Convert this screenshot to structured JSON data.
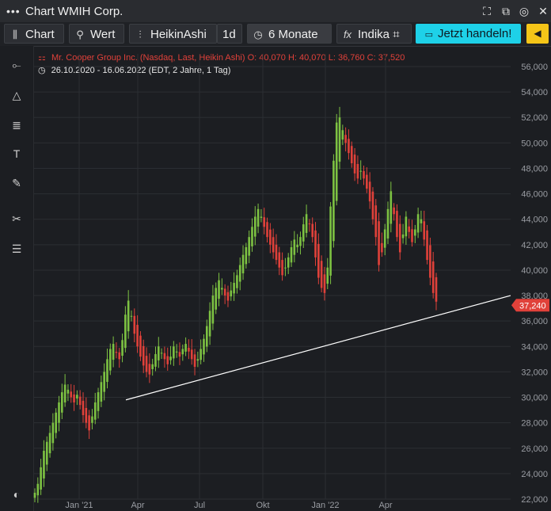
{
  "window": {
    "title": "Chart WMIH Corp."
  },
  "toolbar": {
    "chart_label": "Chart",
    "wert_label": "Wert",
    "type_label": "HeikinAshi",
    "interval_label": "1d",
    "range_label": "6 Monate",
    "indicators_label": "Indika",
    "trade_label": "Jetzt handeln!"
  },
  "legend": {
    "instrument": "Mr. Cooper Group Inc. (Nasdaq, Last, Heikin Ashi)",
    "o": "O: 40,070",
    "h": "H: 40,070",
    "l": "L: 36,760",
    "c": "C: 37,520",
    "range": "26.10.2020 - 16.06.2022",
    "info": "(EDT, 2 Jahre, 1 Tag)"
  },
  "colors": {
    "up": "#7dc242",
    "down": "#e0413a",
    "trendline": "#ffffff",
    "price_tag": "#e0413a",
    "cta": "#1ed1e8"
  },
  "chart_data": {
    "type": "candlestick",
    "y_ticks": [
      "56,000",
      "54,000",
      "52,000",
      "50,000",
      "48,000",
      "46,000",
      "44,000",
      "42,000",
      "40,000",
      "38,000",
      "36,000",
      "34,000",
      "32,000",
      "30,000",
      "28,000",
      "26,000",
      "24,000",
      "22,000"
    ],
    "ylim": [
      22,
      56
    ],
    "x_ticks": [
      "Jan '21",
      "Apr",
      "Jul",
      "Okt",
      "Jan '22",
      "Apr"
    ],
    "last_price_label": "37,240",
    "last_price": 37.24,
    "series_closes": [
      22.5,
      23.2,
      24.5,
      25.8,
      26.5,
      27.2,
      28.0,
      28.8,
      29.6,
      30.4,
      31.0,
      30.6,
      30.0,
      29.6,
      30.2,
      29.4,
      28.6,
      28.0,
      27.4,
      28.5,
      29.6,
      30.4,
      31.2,
      32.0,
      33.0,
      33.8,
      34.2,
      33.5,
      33.0,
      34.5,
      36.5,
      37.6,
      36.4,
      35.0,
      34.0,
      33.2,
      32.5,
      32.0,
      31.8,
      32.6,
      33.4,
      34.0,
      33.5,
      33.0,
      32.6,
      33.2,
      34.0,
      33.6,
      33.2,
      33.8,
      34.2,
      33.6,
      33.0,
      32.4,
      33.0,
      33.8,
      34.6,
      35.6,
      36.8,
      38.0,
      38.6,
      39.2,
      38.6,
      38.0,
      37.6,
      38.4,
      39.0,
      39.6,
      40.4,
      41.2,
      41.8,
      42.6,
      43.4,
      44.2,
      44.8,
      44.2,
      43.4,
      42.6,
      42.0,
      41.4,
      40.8,
      40.2,
      39.6,
      40.2,
      41.0,
      41.8,
      42.4,
      42.0,
      42.6,
      43.6,
      44.4,
      43.6,
      42.6,
      41.0,
      39.4,
      38.6,
      38.2,
      40.2,
      45.0,
      48.6,
      51.6,
      52.0,
      51.0,
      50.0,
      49.2,
      48.4,
      47.6,
      47.2,
      47.8,
      47.2,
      46.4,
      45.4,
      44.0,
      42.6,
      40.4,
      41.4,
      43.2,
      44.8,
      46.2,
      44.4,
      42.6,
      41.4,
      42.8,
      44.2,
      43.0,
      42.2,
      43.2,
      44.4,
      44.0,
      42.4,
      40.8,
      39.4,
      38.2,
      37.52
    ],
    "trendline": {
      "from": {
        "date": "Mar '21",
        "price": 29.8
      },
      "to": {
        "date": "Jul '22",
        "price": 38.0
      }
    }
  }
}
